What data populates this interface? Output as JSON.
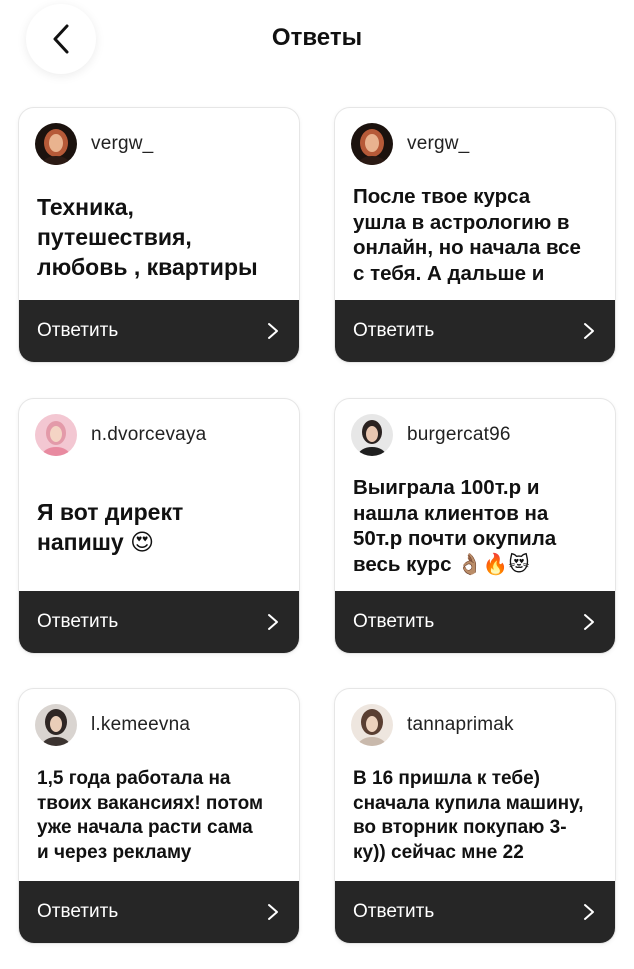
{
  "header": {
    "title": "Ответы"
  },
  "cards": [
    {
      "username": "vergw_",
      "text": "Техника,\nпутешествия,\nлюбовь , квартиры",
      "reply_label": "Ответить",
      "avatar_color": "#3a2a22"
    },
    {
      "username": "vergw_",
      "text": "После твое курса\nушла в астрологию в\nонлайн, но начала все\nс тебя. А дальше и",
      "reply_label": "Ответить",
      "avatar_color": "#3a2a22"
    },
    {
      "username": "n.dvorcevaya",
      "text": "Я вот директ\nнапишу 😍",
      "reply_label": "Ответить",
      "avatar_color": "#e8a6b6"
    },
    {
      "username": "burgercat96",
      "text": "Выиграла 100т.р и\nнашла клиентов на\n50т.р почти окупила\nвесь курс 👌🏽🔥😻",
      "reply_label": "Ответить",
      "avatar_color": "#cfcfcf"
    },
    {
      "username": "l.kemeevna",
      "text": "1,5 года работала на\nтвоих вакансиях! потом\nуже начала расти сама\nи через рекламу",
      "reply_label": "Ответить",
      "avatar_color": "#5a4a44"
    },
    {
      "username": "tannaprimak",
      "text": "В 16 пришла к тебе)\nсначала купила машину,\nво вторник покупаю 3-\nку)) сейчас мне 22",
      "reply_label": "Ответить",
      "avatar_color": "#8a6a5a"
    }
  ]
}
